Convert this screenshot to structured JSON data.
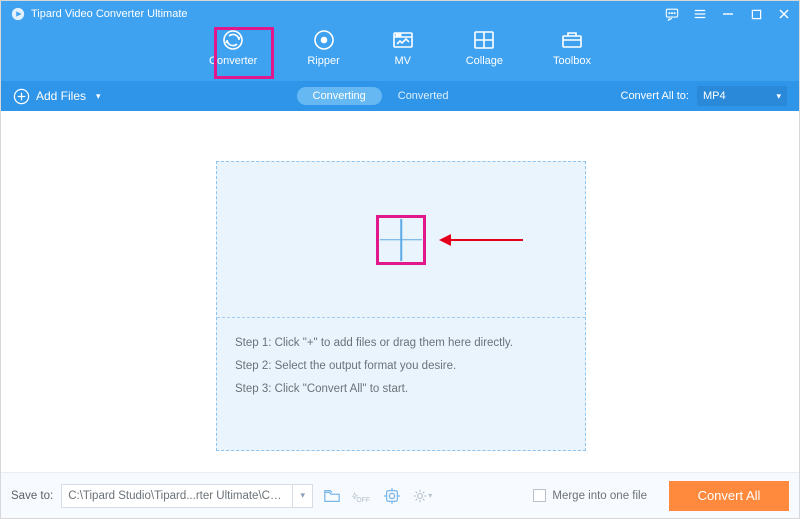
{
  "app": {
    "title": "Tipard Video Converter Ultimate"
  },
  "tabs": {
    "converter": "Converter",
    "ripper": "Ripper",
    "mv": "MV",
    "collage": "Collage",
    "toolbox": "Toolbox",
    "active": "converter"
  },
  "subheader": {
    "add_files": "Add Files",
    "converting": "Converting",
    "converted": "Converted",
    "convert_all_to": "Convert All to:",
    "format": "MP4"
  },
  "dropzone": {
    "step1": "Step 1: Click \"+\" to add files or drag them here directly.",
    "step2": "Step 2: Select the output format you desire.",
    "step3": "Step 3: Click \"Convert All\" to start."
  },
  "footer": {
    "save_to_label": "Save to:",
    "save_path": "C:\\Tipard Studio\\Tipard...rter Ultimate\\Converted",
    "merge_label": "Merge into one file",
    "convert_all": "Convert All"
  }
}
